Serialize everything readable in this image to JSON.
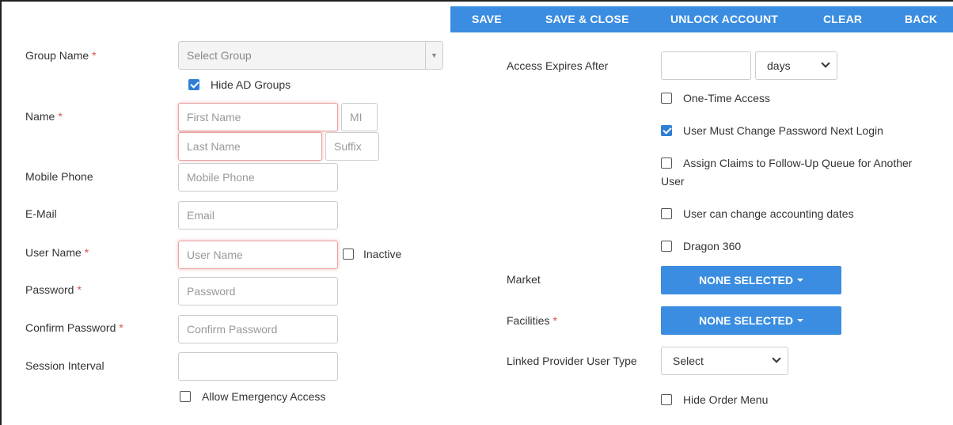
{
  "toolbar": {
    "save": "SAVE",
    "save_close": "SAVE & CLOSE",
    "unlock": "UNLOCK ACCOUNT",
    "clear": "CLEAR",
    "back": "BACK"
  },
  "left": {
    "group_name_label": "Group Name",
    "group_select_value": "Select Group",
    "hide_ad_groups": "Hide AD Groups",
    "name_label": "Name",
    "first_name_ph": "First Name",
    "mi_ph": "MI",
    "last_name_ph": "Last Name",
    "suffix_ph": "Suffix",
    "mobile_label": "Mobile Phone",
    "mobile_ph": "Mobile Phone",
    "email_label": "E-Mail",
    "email_ph": "Email",
    "username_label": "User Name",
    "username_ph": "User Name",
    "inactive": "Inactive",
    "password_label": "Password",
    "password_ph": "Password",
    "confirm_label": "Confirm Password",
    "confirm_ph": "Confirm Password",
    "session_label": "Session Interval",
    "emergency": "Allow Emergency Access",
    "required_mark": "*"
  },
  "right": {
    "access_label": "Access Expires After",
    "access_unit": "days",
    "one_time": "One-Time Access",
    "must_change": "User Must Change Password Next Login",
    "assign_claims_1": "Assign Claims to Follow-Up Queue for Another",
    "assign_claims_2": "User",
    "acct_dates": "User can change accounting dates",
    "dragon": "Dragon 360",
    "market_label": "Market",
    "market_value": "NONE SELECTED",
    "facilities_label": "Facilities",
    "facilities_value": "NONE SELECTED",
    "linked_label": "Linked Provider User Type",
    "linked_value": "Select",
    "hide_order": "Hide Order Menu"
  },
  "colors": {
    "accent": "#3a8de0",
    "required": "#d9534f",
    "checkbox_checked": "#2f7fd6"
  }
}
